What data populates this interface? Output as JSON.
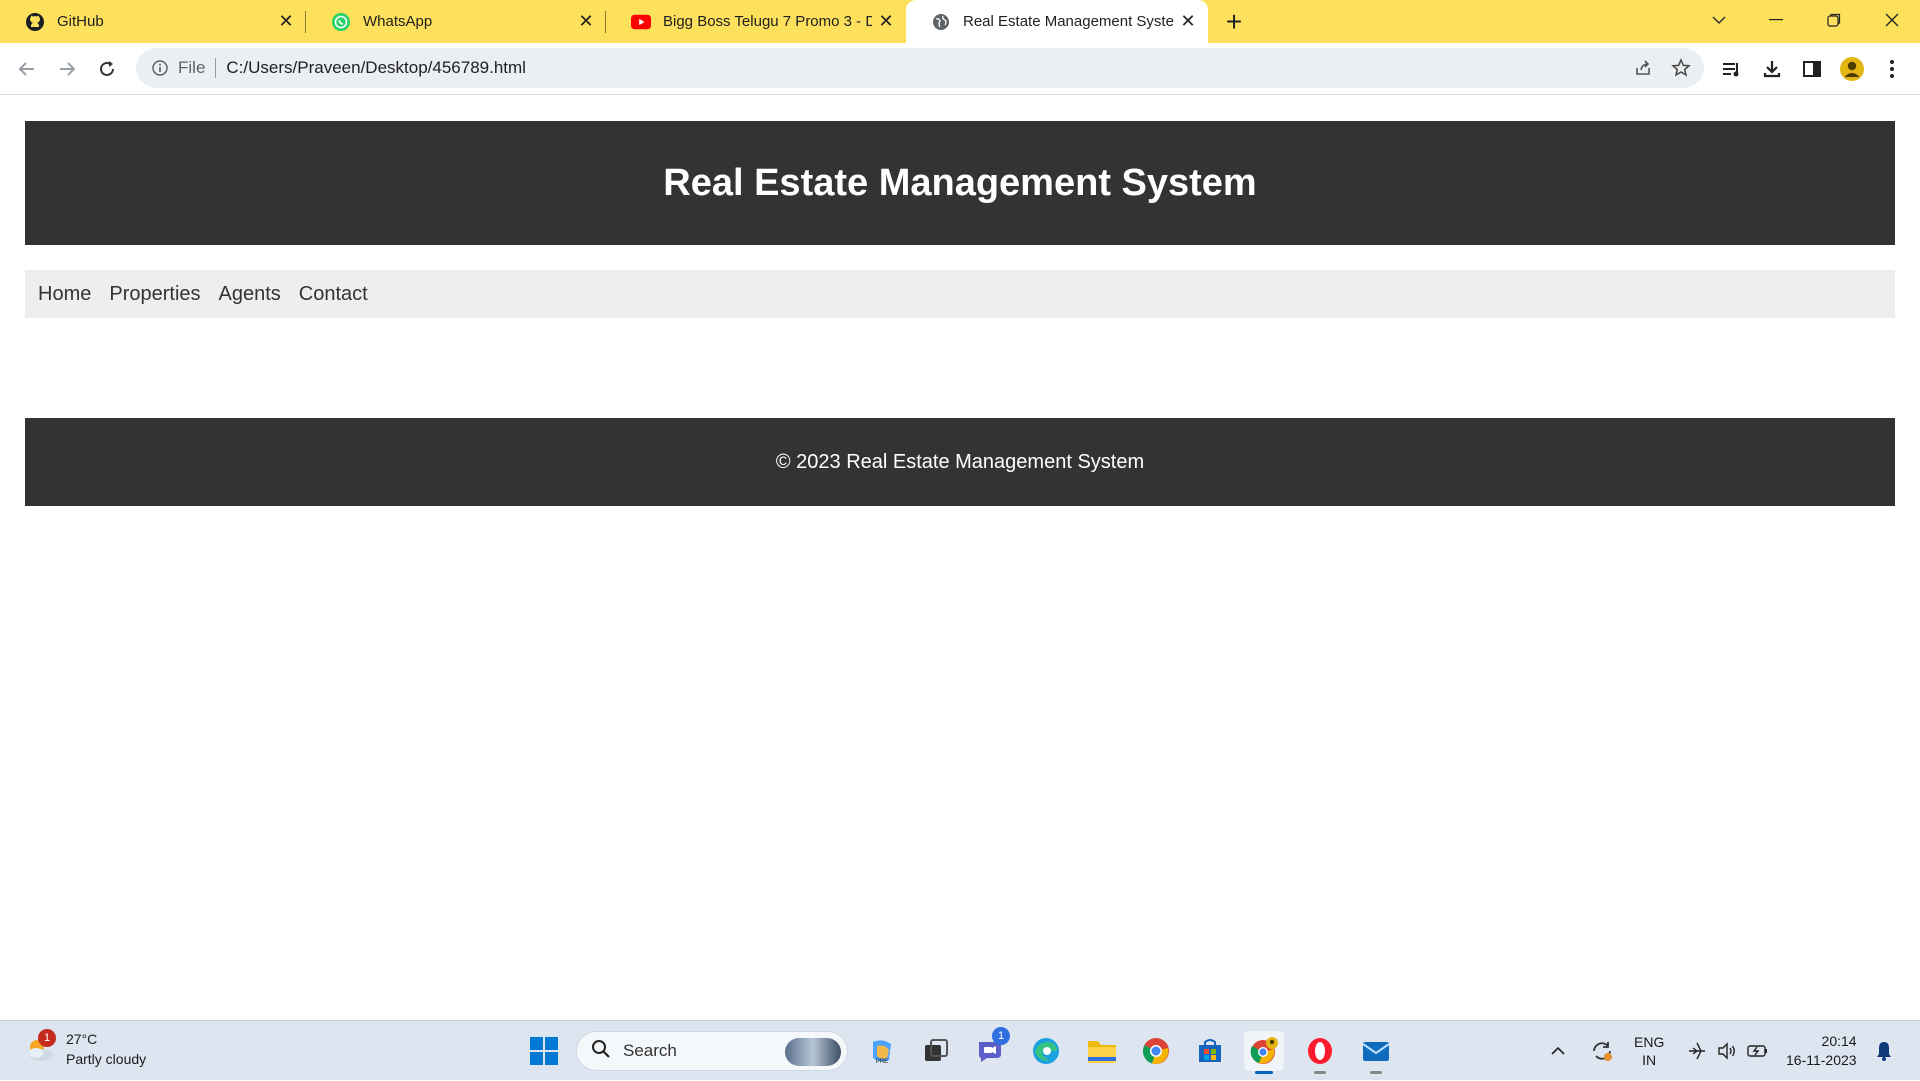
{
  "browser": {
    "tabs": [
      {
        "title": "GitHub",
        "icon": "github-icon"
      },
      {
        "title": "WhatsApp",
        "icon": "whatsapp-icon"
      },
      {
        "title": "Bigg Boss Telugu 7 Promo 3 - D",
        "icon": "youtube-icon"
      },
      {
        "title": "Real Estate Management System",
        "icon": "globe-icon",
        "active": true
      }
    ],
    "address": {
      "scheme_label": "File",
      "url": "C:/Users/Praveen/Desktop/456789.html"
    },
    "colors": {
      "tabbar": "#fde05b"
    }
  },
  "page": {
    "header_title": "Real Estate Management System",
    "nav": [
      "Home",
      "Properties",
      "Agents",
      "Contact"
    ],
    "footer_text": "© 2023 Real Estate Management System",
    "colors": {
      "header_bg": "#333333",
      "nav_bg": "#eeeeee"
    }
  },
  "taskbar": {
    "weather": {
      "temp": "27°C",
      "condition": "Partly cloudy",
      "badge": "1"
    },
    "search_label": "Search",
    "teams_badge": "1",
    "language": {
      "line1": "ENG",
      "line2": "IN"
    },
    "clock": {
      "time": "20:14",
      "date": "16-11-2023"
    }
  }
}
